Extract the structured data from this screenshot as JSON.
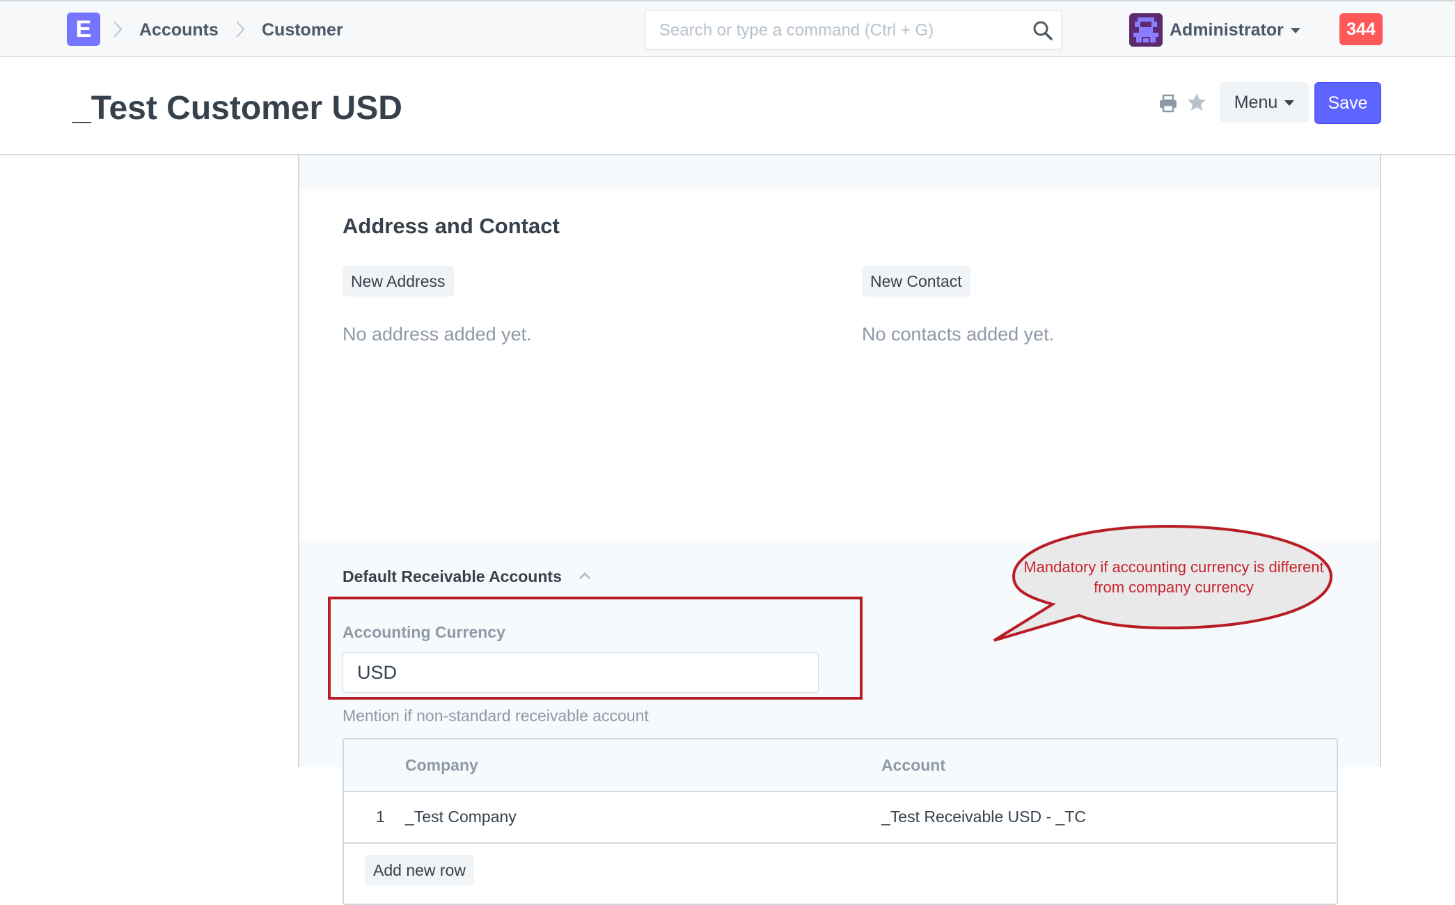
{
  "navbar": {
    "logo_letter": "E",
    "breadcrumbs": [
      "Accounts",
      "Customer"
    ],
    "search_placeholder": "Search or type a command (Ctrl + G)",
    "user_name": "Administrator",
    "notification_count": "344"
  },
  "page": {
    "title": "_Test Customer USD",
    "menu_label": "Menu",
    "save_label": "Save"
  },
  "address_section": {
    "title": "Address and Contact",
    "new_address_label": "New Address",
    "new_contact_label": "New Contact",
    "no_address_text": "No address added yet.",
    "no_contact_text": "No contacts added yet."
  },
  "accounts_section": {
    "title": "Default Receivable Accounts",
    "currency_label": "Accounting Currency",
    "currency_value": "USD",
    "help_text": "Mention if non-standard receivable account",
    "table": {
      "columns": [
        "Company",
        "Account"
      ],
      "rows": [
        {
          "idx": "1",
          "company": "_Test Company",
          "account": "_Test Receivable USD - _TC"
        }
      ],
      "add_row_label": "Add new row"
    }
  },
  "annotation": {
    "text": "Mandatory if accounting currency is different from company currency",
    "color": "#c8242d",
    "highlight_color": "#b81c24"
  },
  "colors": {
    "primary": "#5e64ff",
    "logo": "#7575ff",
    "notification": "#ff5858"
  }
}
